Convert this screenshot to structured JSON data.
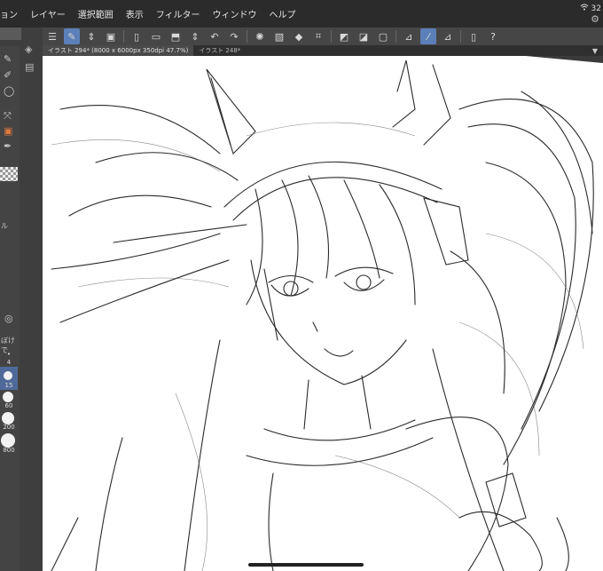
{
  "menubar": {
    "items": [
      "ョン",
      "レイヤー",
      "選択範囲",
      "表示",
      "フィルター",
      "ウィンドウ",
      "ヘルプ"
    ],
    "battery": "32"
  },
  "tabs": [
    {
      "label": "イラスト 294* (8000 x 6000px 350dpi 47.7%)",
      "active": true
    },
    {
      "label": "イラスト 248*",
      "active": false
    }
  ],
  "tool_panel": {
    "label_1": "ル",
    "label_2": "ぼけで",
    "brush_sizes": [
      "4",
      "15",
      "60",
      "200",
      "800"
    ],
    "selected_size": "15"
  },
  "accent_color": "#5b7fb8",
  "canvas": {
    "content": "line-art sketch"
  }
}
